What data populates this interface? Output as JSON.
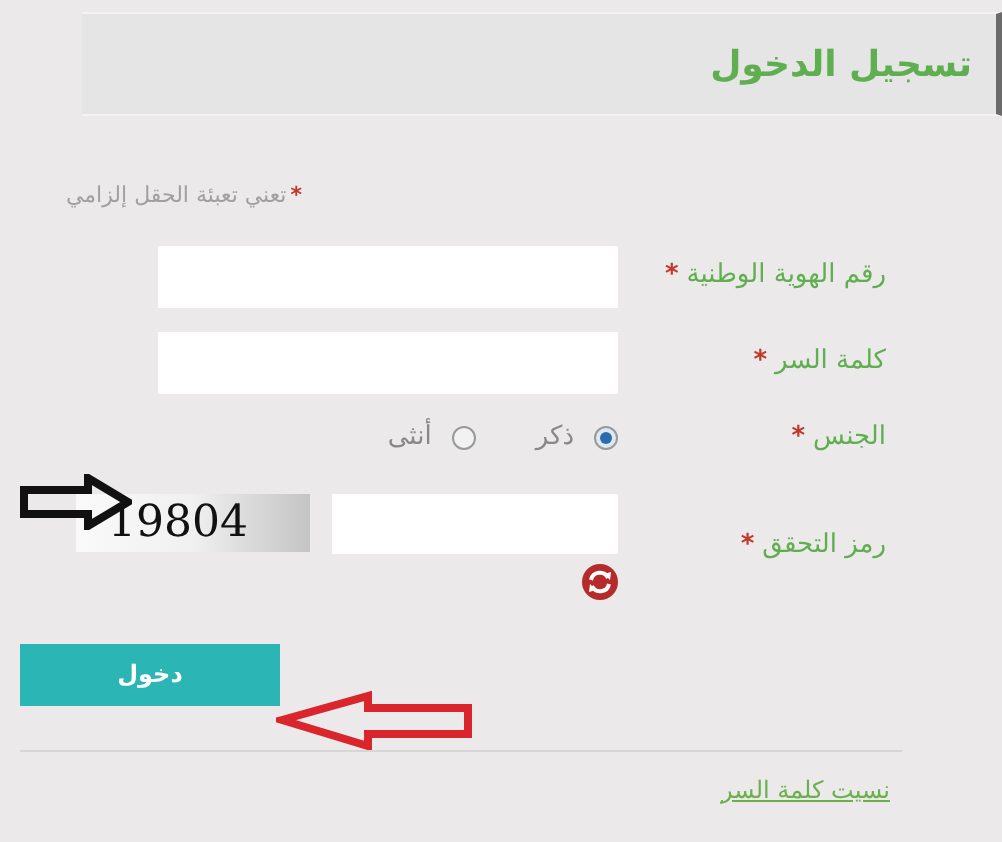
{
  "header": {
    "title": "تسجيل الدخول"
  },
  "required_note": {
    "marker": "*",
    "text": "تعني تعبئة الحقل إلزامي"
  },
  "fields": [
    {
      "kind": "text",
      "label": "رقم الهوية الوطنية",
      "marker": "*"
    },
    {
      "kind": "text",
      "label": "كلمة السر",
      "marker": "*"
    },
    {
      "kind": "radio",
      "label": "الجنس",
      "marker": "*",
      "options": [
        {
          "label": "ذكر",
          "selected": true
        },
        {
          "label": "أنثى",
          "selected": false
        }
      ]
    },
    {
      "kind": "captcha",
      "label": "رمز التحقق",
      "marker": "*",
      "captcha_code": "19804"
    }
  ],
  "login_button": "دخول",
  "forgot_password_link": "نسيت كلمة السر"
}
